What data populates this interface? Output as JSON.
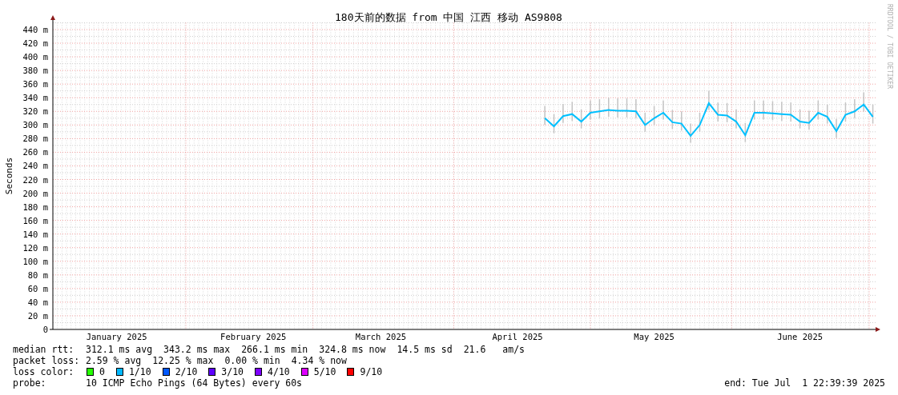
{
  "title": "180天前的数据 from 中国 江西 移动 AS9808",
  "credit": "RRDTOOL / TOBI OETIKER",
  "chart_data": {
    "type": "line",
    "grid": true,
    "ylabel": "Seconds",
    "ylim": [
      0,
      450
    ],
    "yticks": [
      {
        "value": 0,
        "label": "0"
      },
      {
        "value": 20,
        "label": "20 m"
      },
      {
        "value": 40,
        "label": "40 m"
      },
      {
        "value": 60,
        "label": "60 m"
      },
      {
        "value": 80,
        "label": "80 m"
      },
      {
        "value": 100,
        "label": "100 m"
      },
      {
        "value": 120,
        "label": "120 m"
      },
      {
        "value": 140,
        "label": "140 m"
      },
      {
        "value": 160,
        "label": "160 m"
      },
      {
        "value": 180,
        "label": "180 m"
      },
      {
        "value": 200,
        "label": "200 m"
      },
      {
        "value": 220,
        "label": "220 m"
      },
      {
        "value": 240,
        "label": "240 m"
      },
      {
        "value": 260,
        "label": "260 m"
      },
      {
        "value": 280,
        "label": "280 m"
      },
      {
        "value": 300,
        "label": "300 m"
      },
      {
        "value": 320,
        "label": "320 m"
      },
      {
        "value": 340,
        "label": "340 m"
      },
      {
        "value": 360,
        "label": "360 m"
      },
      {
        "value": 380,
        "label": "380 m"
      },
      {
        "value": 400,
        "label": "400 m"
      },
      {
        "value": 420,
        "label": "420 m"
      },
      {
        "value": 440,
        "label": "440 m"
      }
    ],
    "categories": [
      null,
      null,
      null,
      null,
      null,
      null,
      null,
      "January 2025",
      null,
      null,
      null,
      null,
      null,
      null,
      null,
      null,
      null,
      null,
      null,
      null,
      null,
      null,
      "February 2025",
      null,
      null,
      null,
      null,
      null,
      null,
      null,
      null,
      null,
      null,
      null,
      null,
      null,
      "March 2025",
      null,
      null,
      null,
      null,
      null,
      null,
      null,
      null,
      null,
      null,
      null,
      null,
      null,
      null,
      "April 2025",
      null,
      null,
      null,
      null,
      null,
      null,
      null,
      null,
      null,
      null,
      null,
      null,
      null,
      null,
      "May 2025",
      null,
      null,
      null,
      null,
      null,
      null,
      null,
      null,
      null,
      null,
      null,
      null,
      null,
      null,
      null,
      "June 2025",
      null,
      null,
      null,
      null,
      null,
      null,
      null,
      null
    ],
    "series": [
      {
        "name": "median rtt:",
        "color": "#00c0ff",
        "values": [
          null,
          null,
          null,
          null,
          null,
          null,
          null,
          null,
          null,
          null,
          null,
          null,
          null,
          null,
          null,
          null,
          null,
          null,
          null,
          null,
          null,
          null,
          null,
          null,
          null,
          null,
          null,
          null,
          null,
          null,
          null,
          null,
          null,
          null,
          null,
          null,
          null,
          null,
          null,
          null,
          null,
          null,
          null,
          null,
          null,
          null,
          null,
          null,
          null,
          null,
          null,
          null,
          null,
          null,
          310,
          298,
          313,
          316,
          305,
          318,
          320,
          322,
          321,
          321,
          320,
          300,
          310,
          318,
          304,
          302,
          284,
          300,
          332,
          315,
          314,
          305,
          285,
          318,
          318,
          317,
          316,
          315,
          305,
          303,
          318,
          312,
          291,
          315,
          320,
          330,
          312
        ]
      }
    ]
  },
  "legend": [
    {
      "items": [
        "312.1 ms avg",
        "343.2 ms max",
        "266.1 ms min",
        "324.8 ms now",
        "14.5 ms sd",
        "21.6",
        "am/s"
      ]
    },
    {
      "label": "packet loss:",
      "items": [
        "2.59 % avg",
        "12.25 % max",
        "0.00 % min",
        "4.34 % now"
      ]
    }
  ],
  "loss_color": {
    "label": "loss color:",
    "items": [
      {
        "label": "0",
        "color": "#26ff00"
      },
      {
        "label": "1/10",
        "color": "#00b8ff"
      },
      {
        "label": "2/10",
        "color": "#0059ff"
      },
      {
        "label": "3/10",
        "color": "#5e00ff"
      },
      {
        "label": "4/10",
        "color": "#7e00ff"
      },
      {
        "label": "5/10",
        "color": "#dd00ff"
      },
      {
        "label": "9/10",
        "color": "#ff0000"
      }
    ]
  },
  "probe": {
    "label": "probe:",
    "text": "10 ICMP Echo Pings (64 Bytes) every 60s"
  },
  "end": "end: Tue Jul  1 22:39:39 2025"
}
